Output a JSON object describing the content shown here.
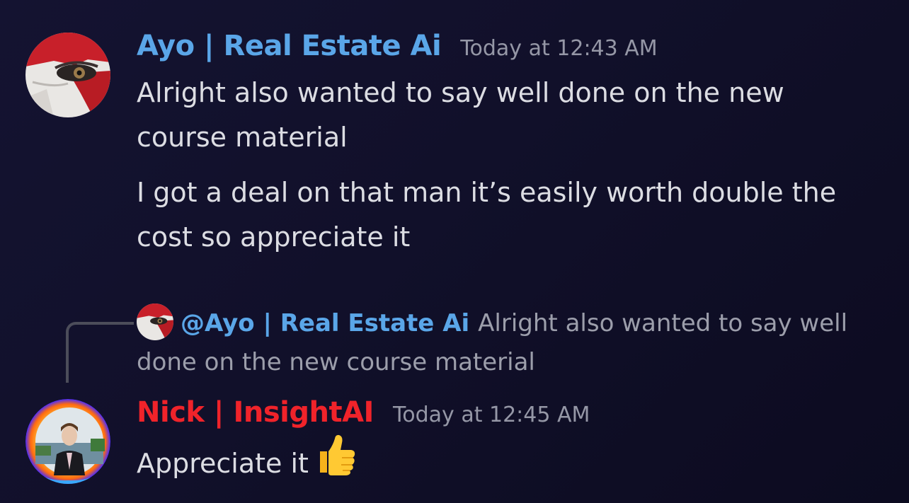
{
  "messages": [
    {
      "author": "Ayo | Real Estate Ai",
      "author_color": "#5aa6e8",
      "timestamp": "Today at 12:43 AM",
      "avatar_icon": "kratos-face-avatar",
      "paragraphs": [
        "Alright also wanted to say well done on the new course material",
        "I got a deal on that man it’s easily worth double the cost so appreciate it"
      ]
    },
    {
      "author": "Nick | InsightAI",
      "author_color": "#f0232a",
      "timestamp": "Today at 12:45 AM",
      "avatar_icon": "portrait-with-fire-frame-avatar",
      "reply": {
        "mention": "@Ayo | Real Estate Ai",
        "preview": "Alright also wanted to say well done on the new course material"
      },
      "text": "Appreciate it",
      "emoji": "thumbs-up-icon"
    }
  ]
}
